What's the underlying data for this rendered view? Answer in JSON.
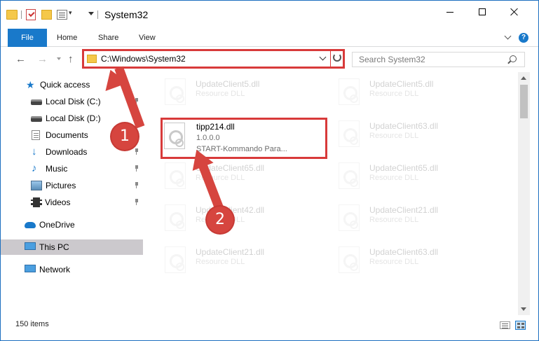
{
  "window": {
    "title": "System32"
  },
  "ribbon": {
    "tabs": [
      "File",
      "Home",
      "Share",
      "View"
    ],
    "help": "?"
  },
  "nav": {
    "address": "C:\\Windows\\System32",
    "search_placeholder": "Search System32"
  },
  "sidebar": {
    "items": [
      {
        "label": "Quick access",
        "icon": "star-icon",
        "pinned": false
      },
      {
        "label": "Local Disk (C:)",
        "icon": "disk-icon",
        "pinned": true
      },
      {
        "label": "Local Disk (D:)",
        "icon": "disk-icon",
        "pinned": true
      },
      {
        "label": "Documents",
        "icon": "documents-icon",
        "pinned": true
      },
      {
        "label": "Downloads",
        "icon": "download-icon",
        "pinned": true
      },
      {
        "label": "Music",
        "icon": "music-icon",
        "pinned": true
      },
      {
        "label": "Pictures",
        "icon": "pictures-icon",
        "pinned": true
      },
      {
        "label": "Videos",
        "icon": "videos-icon",
        "pinned": true
      },
      {
        "label": "OneDrive",
        "icon": "cloud-icon",
        "pinned": false
      },
      {
        "label": "This PC",
        "icon": "computer-icon",
        "pinned": false,
        "selected": true
      },
      {
        "label": "Network",
        "icon": "network-icon",
        "pinned": false
      }
    ]
  },
  "files": {
    "highlighted": {
      "name": "tipp214.dll",
      "version": "1.0.0.0",
      "description": "START-Kommando Para..."
    },
    "faded": [
      {
        "name": "UpdateClient5.dll",
        "type": "Resource DLL"
      },
      {
        "name": "UpdateClient5.dll",
        "type": "Resource DLL"
      },
      {
        "name": "UpdateClient63.dll",
        "type": "Resource DLL"
      },
      {
        "name": "UpdateClient65.dll",
        "type": "Resource DLL"
      },
      {
        "name": "UpdateClient65.dll",
        "type": "Resource DLL"
      },
      {
        "name": "UpdateClient42.dll",
        "type": "Resource DLL"
      },
      {
        "name": "UpdateClient21.dll",
        "type": "Resource DLL"
      },
      {
        "name": "UpdateClient21.dll",
        "type": "Resource DLL"
      },
      {
        "name": "UpdateClient63.dll",
        "type": "Resource DLL"
      }
    ]
  },
  "status": {
    "item_count": "150 items"
  },
  "annotations": {
    "step1": "1",
    "step2": "2"
  },
  "colors": {
    "accent": "#1979ca",
    "annotation_red": "#d6453f",
    "selected_bg": "#ccc9cd"
  }
}
